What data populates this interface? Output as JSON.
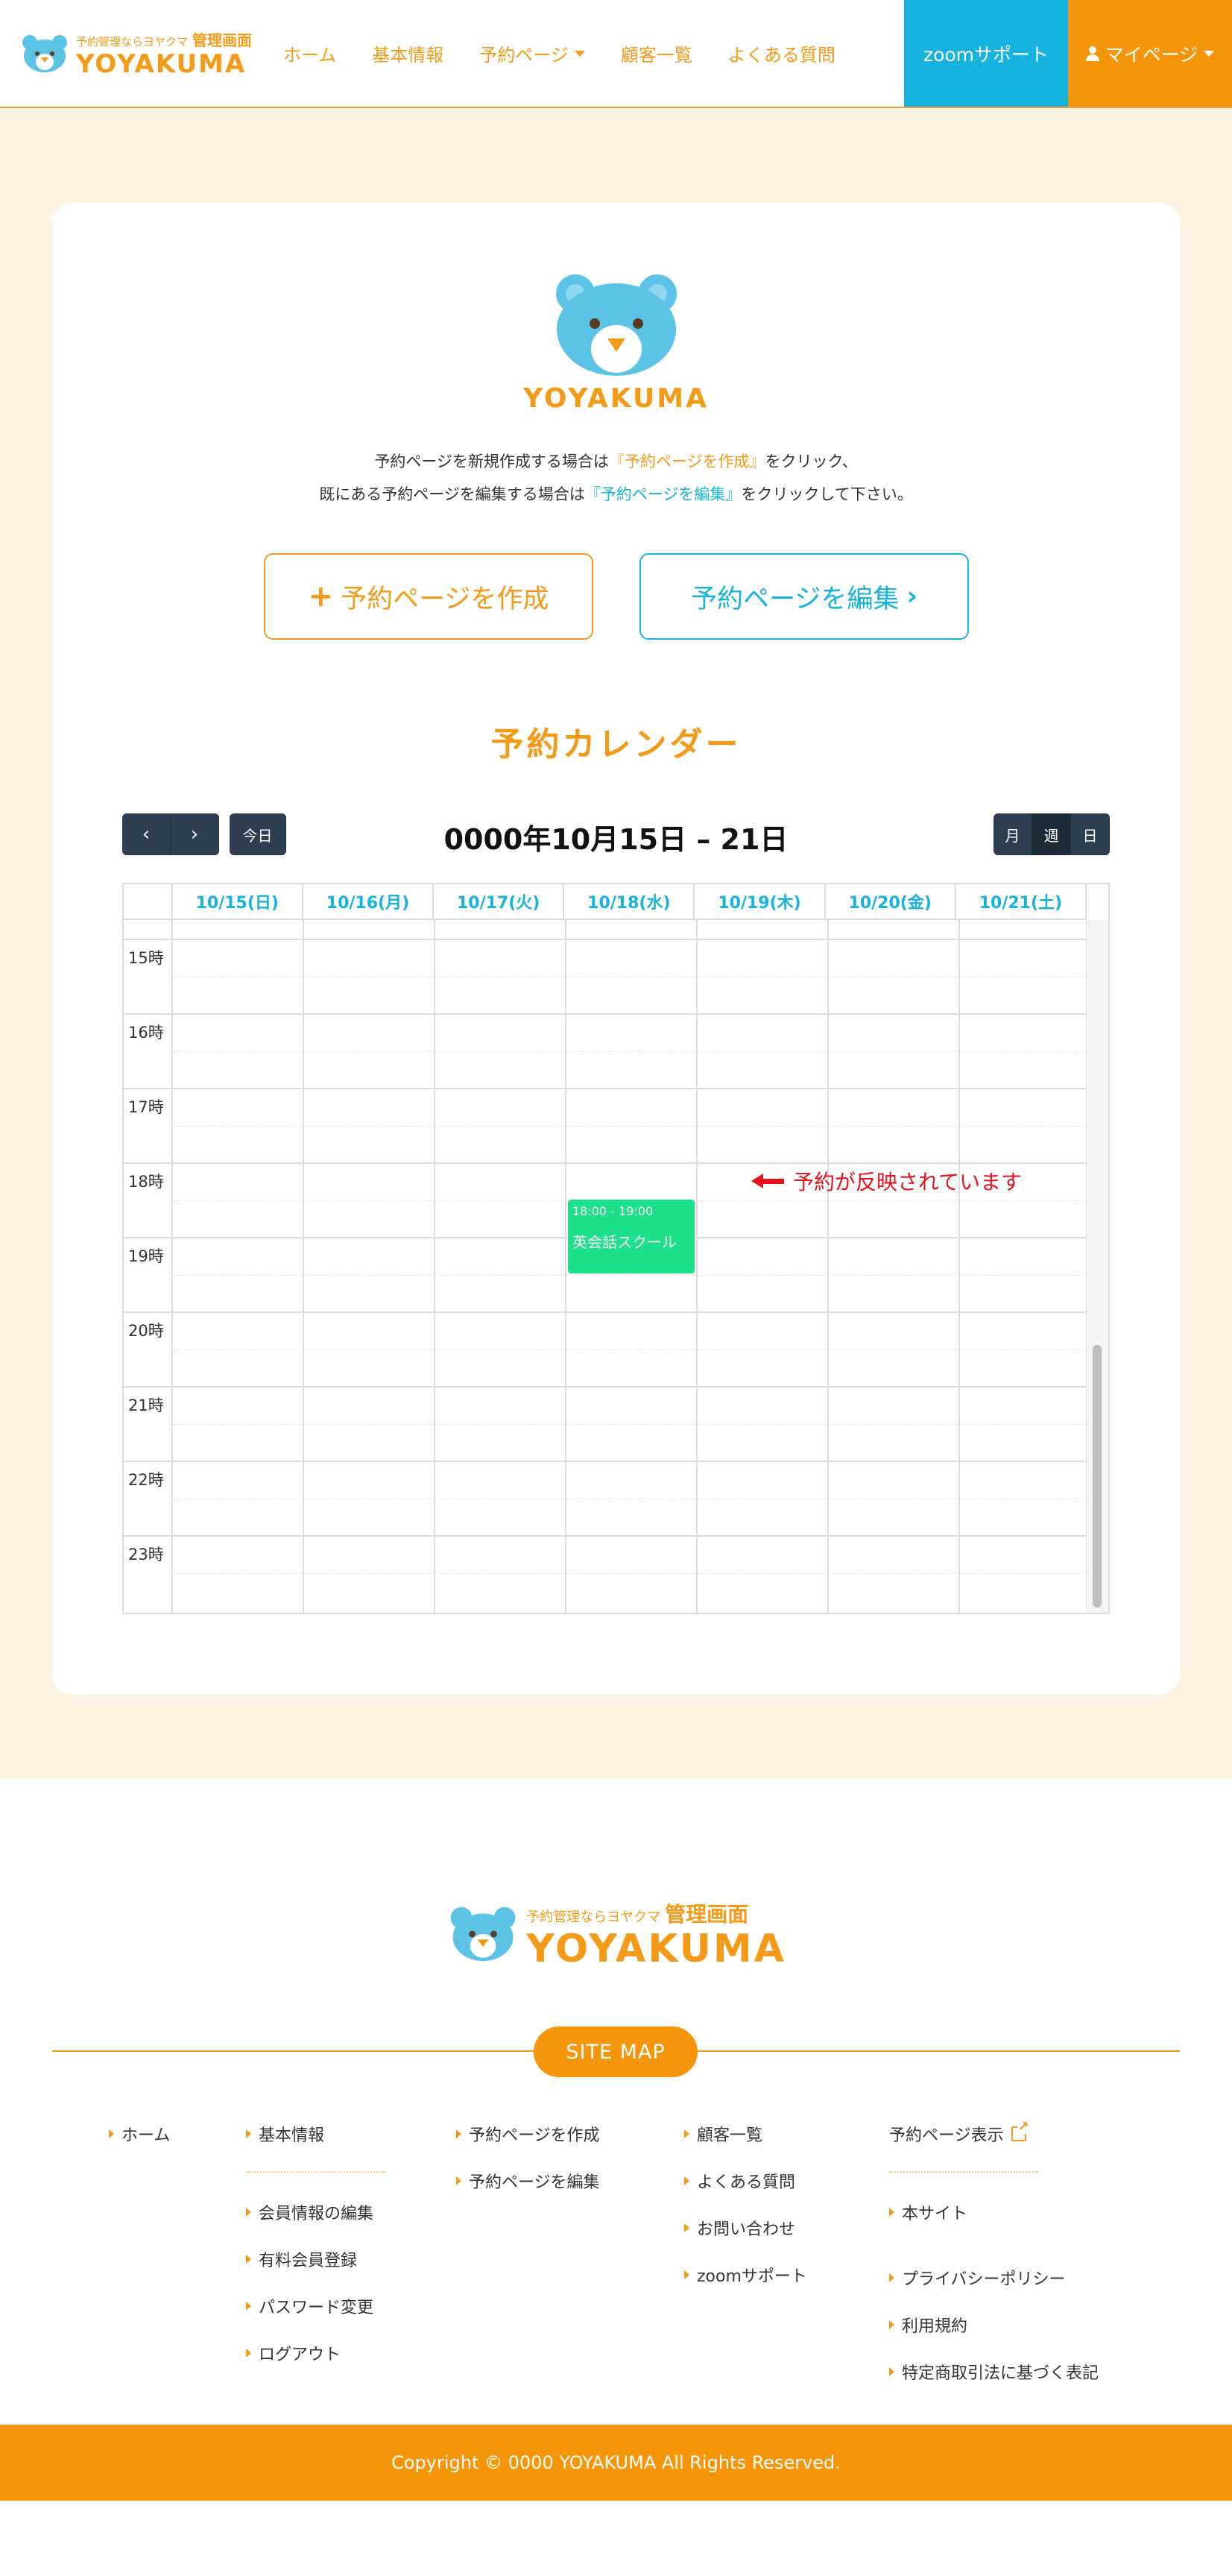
{
  "header": {
    "logo_sub": "予約管理ならヨヤクマ",
    "logo_badge": "管理画面",
    "logo_main": "YOYAKUMA",
    "nav": [
      {
        "label": "ホーム"
      },
      {
        "label": "基本情報"
      },
      {
        "label": "予約ページ"
      },
      {
        "label": "顧客一覧"
      },
      {
        "label": "よくある質問"
      }
    ],
    "zoom_label": "zoomサポート",
    "mypage_label": "マイページ"
  },
  "intro": {
    "logo_text": "YOYAKUMA",
    "line1_prefix": "予約ページを新規作成する場合は",
    "line1_link": "『予約ページを作成』",
    "line1_suffix": "をクリック、",
    "line2_prefix": "既にある予約ページを編集する場合は",
    "line2_link": "『予約ページを編集』",
    "line2_suffix": "をクリックして下さい。",
    "create_button": "予約ページを作成",
    "edit_button": "予約ページを編集"
  },
  "calendar": {
    "title": "予約カレンダー",
    "prev": "‹",
    "next": "›",
    "today": "今日",
    "range": "0000年10月15日 – 21日",
    "views": [
      "月",
      "週",
      "日"
    ],
    "active_view": "週",
    "days": [
      "10/15(日)",
      "10/16(月)",
      "10/17(火)",
      "10/18(水)",
      "10/19(木)",
      "10/20(金)",
      "10/21(土)"
    ],
    "hours": [
      "15時",
      "16時",
      "17時",
      "18時",
      "19時",
      "20時",
      "21時",
      "22時",
      "23時"
    ],
    "event": {
      "time": "18:00 - 19:00",
      "title": "英会話スクール",
      "day": "10/18(水)",
      "color": "#1de08a"
    },
    "annotation": "予約が反映されています"
  },
  "footer": {
    "logo_sub": "予約管理ならヨヤクマ",
    "logo_badge": "管理画面",
    "logo_main": "YOYAKUMA",
    "sitemap_label": "SITE MAP",
    "links": {
      "home": "ホーム",
      "basic_info": "基本情報",
      "edit_member": "会員情報の編集",
      "paid_member": "有料会員登録",
      "password_change": "パスワード変更",
      "logout": "ログアウト",
      "create_page": "予約ページを作成",
      "edit_page": "予約ページを編集",
      "customers": "顧客一覧",
      "faq": "よくある質問",
      "contact": "お問い合わせ",
      "zoom_support": "zoomサポート",
      "view_page": "予約ページ表示",
      "main_site": "本サイト",
      "privacy": "プライバシーポリシー",
      "terms": "利用規約",
      "tokusho": "特定商取引法に基づく表記"
    },
    "copyright": "Copyright © 0000 YOYAKUMA All Rights Reserved."
  },
  "colors": {
    "brand_orange": "#f59a16",
    "brand_blue": "#15b3de",
    "page_bg": "#fdf3e3",
    "toolbar_dark": "#2c3e50",
    "annotation_red": "#e6121b"
  }
}
